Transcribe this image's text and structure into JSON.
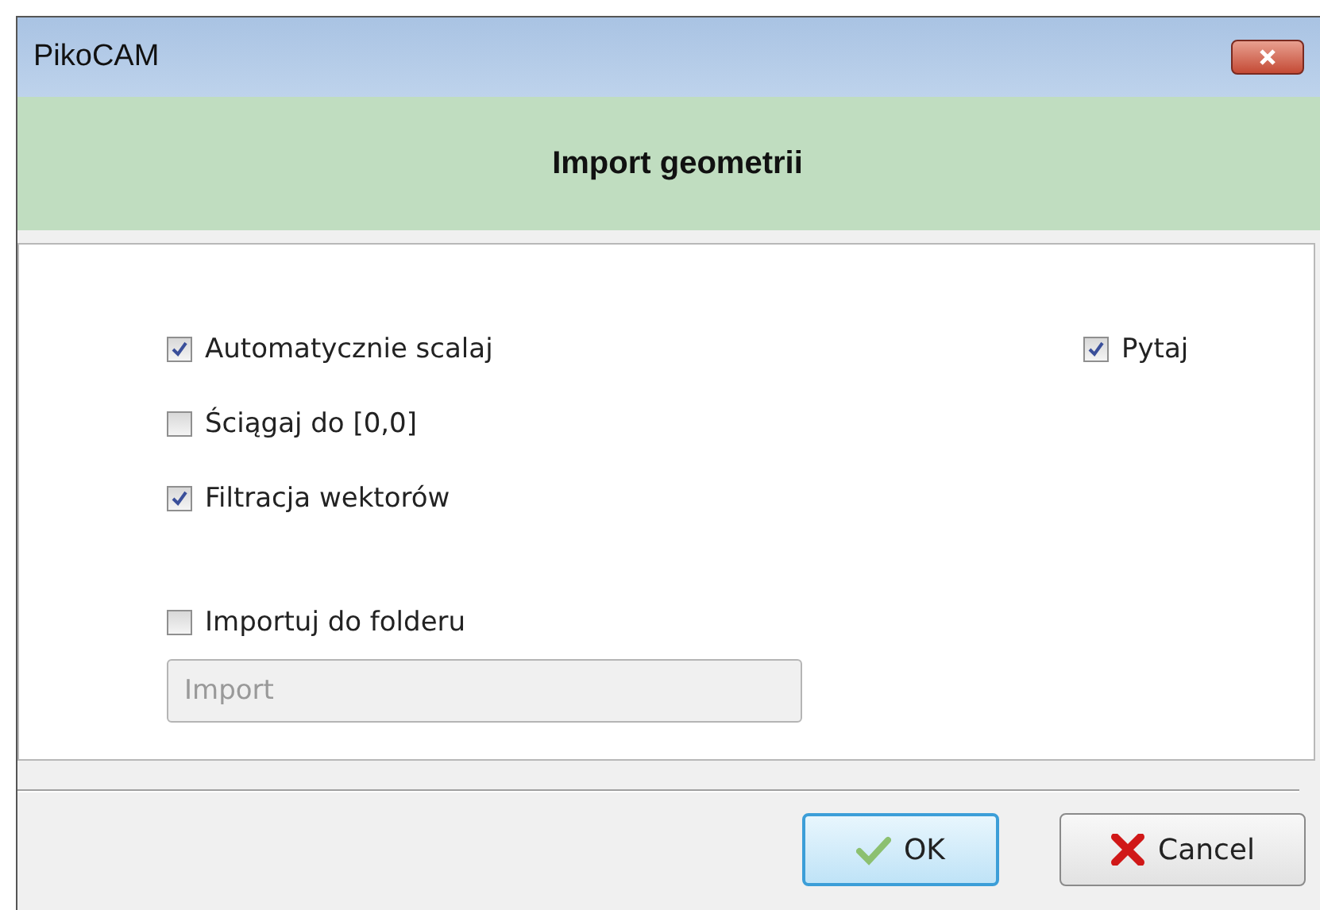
{
  "window": {
    "title": "PikoCAM"
  },
  "header": {
    "title": "Import geometrii"
  },
  "options": [
    {
      "label": "Automatycznie scalaj",
      "checked": true
    },
    {
      "label": "Ściągaj do [0,0]",
      "checked": false
    },
    {
      "label": "Filtracja wektorów",
      "checked": true
    }
  ],
  "ask": {
    "label": "Pytaj",
    "checked": true
  },
  "folder": {
    "label": "Importuj do folderu",
    "checked": false
  },
  "folder_field": {
    "value": "Import",
    "disabled": true
  },
  "buttons": [
    {
      "kind": "ok",
      "label": "OK",
      "selected": true
    },
    {
      "kind": "cancel",
      "label": "Cancel",
      "selected": false
    }
  ]
}
